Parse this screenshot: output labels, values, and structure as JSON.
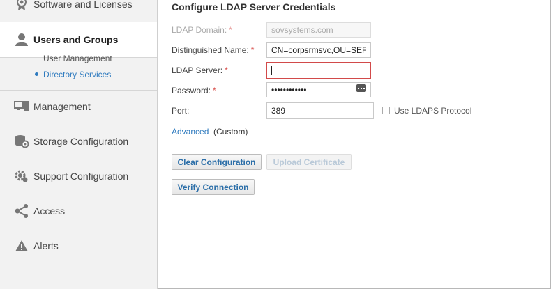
{
  "sidebar": {
    "items": [
      {
        "label": "Software and Licenses",
        "icon": "badge-icon"
      },
      {
        "label": "Users and Groups",
        "icon": "user-icon",
        "active": true
      },
      {
        "label": "Management",
        "icon": "monitor-icon"
      },
      {
        "label": "Storage Configuration",
        "icon": "storage-icon"
      },
      {
        "label": "Support Configuration",
        "icon": "support-gear-icon"
      },
      {
        "label": "Access",
        "icon": "share-icon"
      },
      {
        "label": "Alerts",
        "icon": "warning-icon"
      }
    ],
    "subitems": [
      {
        "label": "User Management"
      },
      {
        "label": "Directory Services",
        "selected": true
      }
    ]
  },
  "form": {
    "title": "Configure LDAP Server Credentials",
    "domain_label": "LDAP Domain:",
    "domain_value": "sovsystems.com",
    "dn_label": "Distinguished Name:",
    "dn_value": "CN=corpsrmsvc,OU=SEF",
    "server_label": "LDAP Server:",
    "server_value": "",
    "password_label": "Password:",
    "password_value": "••••••••••••",
    "port_label": "Port:",
    "port_value": "389",
    "ldaps_label": "Use LDAPS Protocol",
    "advanced_link": "Advanced",
    "advanced_state": "(Custom)",
    "required_marker": "*"
  },
  "buttons": {
    "clear": "Clear Configuration",
    "upload": "Upload Certificate",
    "verify": "Verify Connection"
  },
  "colors": {
    "accent": "#2f7bbf",
    "required": "#d9534f",
    "error_border": "#d24a4a"
  }
}
